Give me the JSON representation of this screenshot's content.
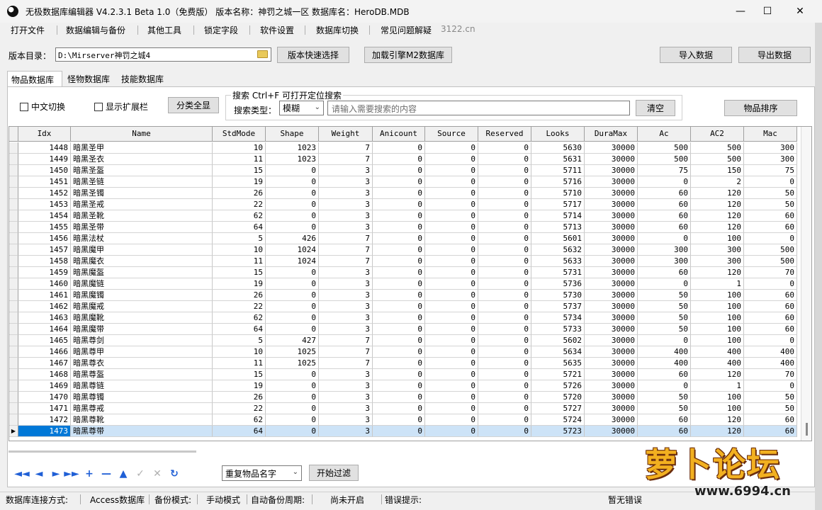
{
  "window": {
    "title": "无极数据库编辑器 V4.2.3.1    Beta 1.0（免费版）    版本名称：神罚之城一区    数据库名：HeroDB.MDB",
    "minimize": "—",
    "maximize": "☐",
    "close": "✕"
  },
  "menu": [
    "打开文件",
    "数据编辑与备份",
    "其他工具",
    "锁定字段",
    "软件设置",
    "数据库切换",
    "常见问题解疑",
    "3122.cn"
  ],
  "toolbar": {
    "path_label": "版本目录：",
    "path_value": "D:\\Mirserver神罚之城4",
    "quick_select": "版本快速选择",
    "load_engine": "加载引擎M2数据库",
    "import": "导入数据",
    "export": "导出数据"
  },
  "tabs": [
    "物品数据库",
    "怪物数据库",
    "技能数据库"
  ],
  "panel": {
    "chinese_toggle": "中文切换",
    "show_ext": "显示扩展栏",
    "show_all": "分类全显",
    "search_legend": "搜索   Ctrl+F 可打开定位搜索",
    "search_type_label": "搜索类型：",
    "search_type_value": "模糊",
    "search_placeholder": "请输入需要搜索的内容",
    "clear": "清空",
    "sort": "物品排序"
  },
  "table": {
    "columns": [
      "Idx",
      "Name",
      "StdMode",
      "Shape",
      "Weight",
      "Anicount",
      "Source",
      "Reserved",
      "Looks",
      "DuraMax",
      "Ac",
      "AC2",
      "Mac"
    ],
    "rows": [
      [
        "1448",
        "暗黑圣甲",
        "10",
        "1023",
        "7",
        "0",
        "0",
        "0",
        "5630",
        "30000",
        "500",
        "500",
        "300"
      ],
      [
        "1449",
        "暗黑圣衣",
        "11",
        "1023",
        "7",
        "0",
        "0",
        "0",
        "5631",
        "30000",
        "500",
        "500",
        "300"
      ],
      [
        "1450",
        "暗黑圣盔",
        "15",
        "0",
        "3",
        "0",
        "0",
        "0",
        "5711",
        "30000",
        "75",
        "150",
        "75"
      ],
      [
        "1451",
        "暗黑圣链",
        "19",
        "0",
        "3",
        "0",
        "0",
        "0",
        "5716",
        "30000",
        "0",
        "2",
        "0"
      ],
      [
        "1452",
        "暗黑圣镯",
        "26",
        "0",
        "3",
        "0",
        "0",
        "0",
        "5710",
        "30000",
        "60",
        "120",
        "50"
      ],
      [
        "1453",
        "暗黑圣戒",
        "22",
        "0",
        "3",
        "0",
        "0",
        "0",
        "5717",
        "30000",
        "60",
        "120",
        "50"
      ],
      [
        "1454",
        "暗黑圣靴",
        "62",
        "0",
        "3",
        "0",
        "0",
        "0",
        "5714",
        "30000",
        "60",
        "120",
        "60"
      ],
      [
        "1455",
        "暗黑圣带",
        "64",
        "0",
        "3",
        "0",
        "0",
        "0",
        "5713",
        "30000",
        "60",
        "120",
        "60"
      ],
      [
        "1456",
        "暗黑法杖",
        "5",
        "426",
        "7",
        "0",
        "0",
        "0",
        "5601",
        "30000",
        "0",
        "100",
        "0"
      ],
      [
        "1457",
        "暗黑魔甲",
        "10",
        "1024",
        "7",
        "0",
        "0",
        "0",
        "5632",
        "30000",
        "300",
        "300",
        "500"
      ],
      [
        "1458",
        "暗黑魔衣",
        "11",
        "1024",
        "7",
        "0",
        "0",
        "0",
        "5633",
        "30000",
        "300",
        "300",
        "500"
      ],
      [
        "1459",
        "暗黑魔盔",
        "15",
        "0",
        "3",
        "0",
        "0",
        "0",
        "5731",
        "30000",
        "60",
        "120",
        "70"
      ],
      [
        "1460",
        "暗黑魔链",
        "19",
        "0",
        "3",
        "0",
        "0",
        "0",
        "5736",
        "30000",
        "0",
        "1",
        "0"
      ],
      [
        "1461",
        "暗黑魔镯",
        "26",
        "0",
        "3",
        "0",
        "0",
        "0",
        "5730",
        "30000",
        "50",
        "100",
        "60"
      ],
      [
        "1462",
        "暗黑魔戒",
        "22",
        "0",
        "3",
        "0",
        "0",
        "0",
        "5737",
        "30000",
        "50",
        "100",
        "60"
      ],
      [
        "1463",
        "暗黑魔靴",
        "62",
        "0",
        "3",
        "0",
        "0",
        "0",
        "5734",
        "30000",
        "50",
        "100",
        "60"
      ],
      [
        "1464",
        "暗黑魔带",
        "64",
        "0",
        "3",
        "0",
        "0",
        "0",
        "5733",
        "30000",
        "50",
        "100",
        "60"
      ],
      [
        "1465",
        "暗黑尊剑",
        "5",
        "427",
        "7",
        "0",
        "0",
        "0",
        "5602",
        "30000",
        "0",
        "100",
        "0"
      ],
      [
        "1466",
        "暗黑尊甲",
        "10",
        "1025",
        "7",
        "0",
        "0",
        "0",
        "5634",
        "30000",
        "400",
        "400",
        "400"
      ],
      [
        "1467",
        "暗黑尊衣",
        "11",
        "1025",
        "7",
        "0",
        "0",
        "0",
        "5635",
        "30000",
        "400",
        "400",
        "400"
      ],
      [
        "1468",
        "暗黑尊盔",
        "15",
        "0",
        "3",
        "0",
        "0",
        "0",
        "5721",
        "30000",
        "60",
        "120",
        "70"
      ],
      [
        "1469",
        "暗黑尊链",
        "19",
        "0",
        "3",
        "0",
        "0",
        "0",
        "5726",
        "30000",
        "0",
        "1",
        "0"
      ],
      [
        "1470",
        "暗黑尊镯",
        "26",
        "0",
        "3",
        "0",
        "0",
        "0",
        "5720",
        "30000",
        "50",
        "100",
        "50"
      ],
      [
        "1471",
        "暗黑尊戒",
        "22",
        "0",
        "3",
        "0",
        "0",
        "0",
        "5727",
        "30000",
        "50",
        "100",
        "50"
      ],
      [
        "1472",
        "暗黑尊靴",
        "62",
        "0",
        "3",
        "0",
        "0",
        "0",
        "5724",
        "30000",
        "60",
        "120",
        "60"
      ],
      [
        "1473",
        "暗黑尊带",
        "64",
        "0",
        "3",
        "0",
        "0",
        "0",
        "5723",
        "30000",
        "60",
        "120",
        "60"
      ]
    ],
    "selected_idx": "1473"
  },
  "bottom": {
    "filter_value": "重复物品名字",
    "filter_button": "开始过滤"
  },
  "status": {
    "conn_label": "数据库连接方式:",
    "conn_value": "Access数据库",
    "backup_label": "备份模式:",
    "backup_value": "手动模式",
    "auto_label": "自动备份周期:",
    "auto_value": "尚未开启",
    "error_label": "错误提示:",
    "error_value": "暂无错误"
  },
  "watermark": {
    "text": "萝卜论坛",
    "url": "www.6994.cn"
  },
  "colors": {
    "selected_row": "#cde3f7",
    "selected_cell": "#0078d7",
    "nav_blue": "#1f5fd6"
  }
}
